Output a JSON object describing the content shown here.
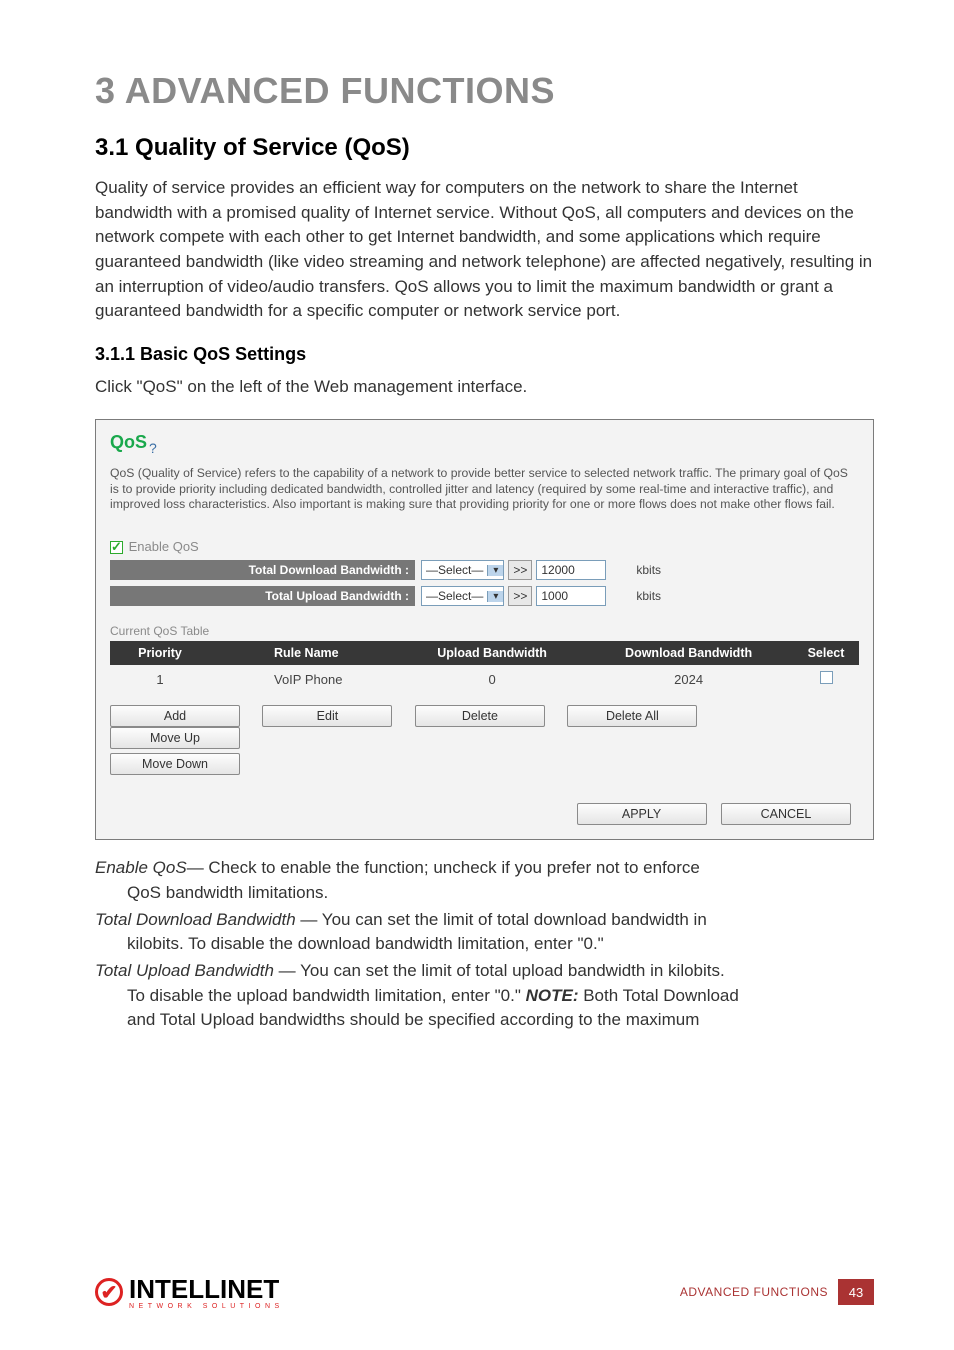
{
  "headings": {
    "h1": "3  ADVANCED FUNCTIONS",
    "h2": "3.1  Quality of Service (QoS)",
    "h3": "3.1.1  Basic QoS Settings"
  },
  "paragraphs": {
    "intro": "Quality of service provides an efficient way for computers on the network to share the Internet bandwidth with a promised quality of Internet service. Without QoS, all computers and devices on the network compete with each other to get Internet bandwidth, and some applications which require guaranteed bandwidth (like video streaming and network telephone) are affected negatively, resulting in an interruption of video/audio transfers. QoS allows you to limit the maximum bandwidth or grant a guaranteed bandwidth for a specific computer or network service port.",
    "click": "Click \"QoS\" on the left of the Web management interface."
  },
  "panel": {
    "title": "QoS",
    "help": "?",
    "desc": "QoS (Quality of Service) refers to the capability of a network to provide better service to selected network traffic. The primary goal of QoS is to provide priority including dedicated bandwidth, controlled jitter and latency (required by some real-time and interactive traffic), and improved loss characteristics. Also important is making sure that providing priority for one or more flows does not make other flows fail.",
    "enable_label": "Enable QoS",
    "dl_label": "Total Download Bandwidth :",
    "ul_label": "Total Upload Bandwidth :",
    "select_text": "—Select—",
    "gtgt": ">>",
    "dl_value": "12000",
    "ul_value": "1000",
    "kbits": "kbits",
    "current_label": "Current QoS Table",
    "columns": {
      "c1": "Priority",
      "c2": "Rule Name",
      "c3": "Upload Bandwidth",
      "c4": "Download Bandwidth",
      "c5": "Select"
    },
    "row": {
      "priority": "1",
      "rule": "VoIP Phone",
      "upload": "0",
      "download": "2024"
    },
    "buttons": {
      "add": "Add",
      "edit": "Edit",
      "delete": "Delete",
      "delete_all": "Delete All",
      "move_up": "Move Up",
      "move_down": "Move Down",
      "apply": "APPLY",
      "cancel": "CANCEL"
    }
  },
  "definitions": {
    "d1_term": "Enable QoS",
    "d1_body1": "— Check to enable the function; uncheck if you prefer not to enforce",
    "d1_body2": "QoS bandwidth limitations.",
    "d2_term": "Total Download Bandwidth",
    "d2_body1": " — You can set the limit of total download bandwidth in",
    "d2_body2": "kilobits. To disable the download bandwidth limitation, enter \"0.\"",
    "d3_term": "Total Upload Bandwidth",
    "d3_body1": " — You can set the limit of total upload bandwidth in kilobits.",
    "d3_body2a": "To disable the upload bandwidth limitation, enter \"0.\" ",
    "d3_note": "NOTE:",
    "d3_body2b": " Both Total Download",
    "d3_body3": "and Total Upload bandwidths should be specified according to the maximum"
  },
  "footer": {
    "brand": "INTELLINET",
    "brand_sub": "NETWORK SOLUTIONS",
    "section": "ADVANCED FUNCTIONS",
    "page": "43"
  }
}
